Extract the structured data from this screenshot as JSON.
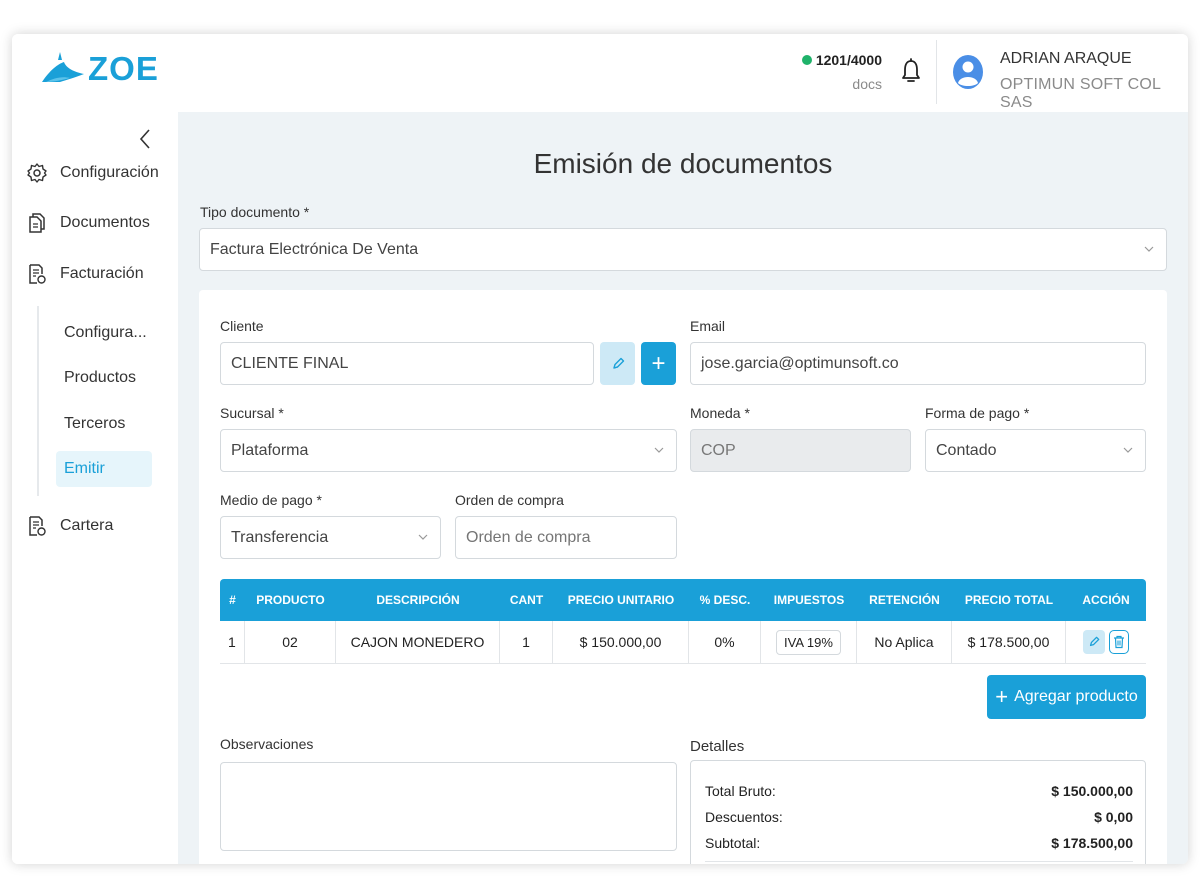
{
  "brand": {
    "name": "ZOE",
    "accent": "#1aa0d8"
  },
  "header": {
    "doc_count": "1201/4000",
    "doc_count_unit": "docs",
    "status_color": "#1fb26a",
    "user_name": "ADRIAN ARAQUE",
    "company": "OPTIMUN SOFT COL SAS"
  },
  "sidebar": {
    "items": [
      {
        "label": "Configuración",
        "icon": "gear-icon"
      },
      {
        "label": "Documentos",
        "icon": "documents-icon"
      },
      {
        "label": "Facturación",
        "icon": "invoice-icon"
      },
      {
        "label": "Cartera",
        "icon": "wallet-document-icon"
      }
    ],
    "sub_items": [
      {
        "label": "Configura..."
      },
      {
        "label": "Productos"
      },
      {
        "label": "Terceros"
      },
      {
        "label": "Emitir",
        "active": true
      }
    ]
  },
  "page": {
    "title": "Emisión de documentos"
  },
  "form": {
    "doc_type_label": "Tipo documento *",
    "doc_type_value": "Factura Electrónica De Venta",
    "client_label": "Cliente",
    "client_value": "CLIENTE FINAL",
    "email_label": "Email",
    "email_value": "jose.garcia@optimunsoft.co",
    "branch_label": "Sucursal *",
    "branch_value": "Plataforma",
    "currency_label": "Moneda *",
    "currency_value": "COP",
    "payment_form_label": "Forma de pago *",
    "payment_form_value": "Contado",
    "payment_method_label": "Medio de pago *",
    "payment_method_value": "Transferencia",
    "purchase_order_label": "Orden de compra",
    "purchase_order_placeholder": "Orden de compra"
  },
  "table": {
    "headers": [
      "#",
      "PRODUCTO",
      "DESCRIPCIÓN",
      "CANT",
      "PRECIO UNITARIO",
      "% DESC.",
      "IMPUESTOS",
      "RETENCIÓN",
      "PRECIO TOTAL",
      "ACCIÓN"
    ],
    "rows": [
      [
        "1",
        "02",
        "CAJON MONEDERO",
        "1",
        "$ 150.000,00",
        "0%",
        "IVA 19%",
        "No Aplica",
        "$ 178.500,00"
      ]
    ]
  },
  "add_product_label": "Agregar producto",
  "observations_label": "Observaciones",
  "details": {
    "title": "Detalles",
    "rows": [
      {
        "label": "Total Bruto:",
        "value": "$ 150.000,00"
      },
      {
        "label": "Descuentos:",
        "value": "$ 0,00"
      },
      {
        "label": "Subtotal:",
        "value": "$ 178.500,00"
      }
    ]
  }
}
